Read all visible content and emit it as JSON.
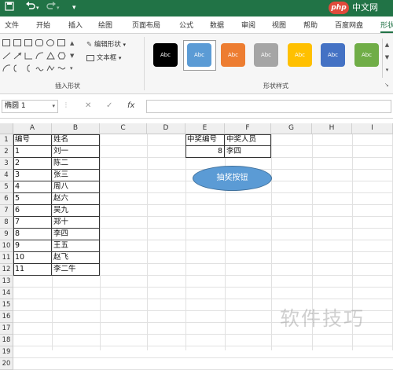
{
  "window": {
    "qat_icons": [
      "save-icon",
      "undo-icon",
      "redo-icon"
    ],
    "watermark_logo": "php",
    "watermark_text": "中文网"
  },
  "tabs": [
    "文件",
    "开始",
    "插入",
    "绘图",
    "页面布局",
    "公式",
    "数据",
    "审阅",
    "视图",
    "帮助",
    "百度网盘",
    "形状"
  ],
  "active_tab": "形状",
  "ribbon": {
    "insert_shapes": {
      "label": "插入形状",
      "edit_shape": "编辑形状",
      "text_box": "文本框"
    },
    "shape_styles": {
      "label": "形状样式",
      "thumb_text": "Abc",
      "thumbs": [
        {
          "color": "#000000"
        },
        {
          "color": "#5b9bd5"
        },
        {
          "color": "#ed7d31"
        },
        {
          "color": "#a5a5a5"
        },
        {
          "color": "#ffc000"
        },
        {
          "color": "#4472c4"
        },
        {
          "color": "#70ad47"
        }
      ]
    }
  },
  "formula_bar": {
    "name_box": "椭圆 1",
    "cancel": "✕",
    "enter": "✓",
    "fx": "fx",
    "value": ""
  },
  "grid": {
    "columns": [
      "A",
      "B",
      "C",
      "D",
      "E",
      "F",
      "G",
      "H",
      "I"
    ],
    "rows": [
      "1",
      "2",
      "3",
      "4",
      "5",
      "6",
      "7",
      "8",
      "9",
      "10",
      "11",
      "12",
      "13",
      "14",
      "15",
      "16",
      "17",
      "18",
      "19",
      "20"
    ],
    "list_headers": [
      "编号",
      "姓名"
    ],
    "list": [
      [
        "1",
        "刘一"
      ],
      [
        "2",
        "陈二"
      ],
      [
        "3",
        "张三"
      ],
      [
        "4",
        "周八"
      ],
      [
        "5",
        "赵六"
      ],
      [
        "6",
        "吴九"
      ],
      [
        "7",
        "郑十"
      ],
      [
        "8",
        "李四"
      ],
      [
        "9",
        "王五"
      ],
      [
        "10",
        "赵飞"
      ],
      [
        "11",
        "李二牛"
      ]
    ],
    "winner_headers": [
      "中奖编号",
      "中奖人员"
    ],
    "winner": [
      "8",
      "李四"
    ]
  },
  "button": {
    "label": "抽奖按钮",
    "color": "#5b9bd5"
  },
  "watermark": "软件技巧"
}
